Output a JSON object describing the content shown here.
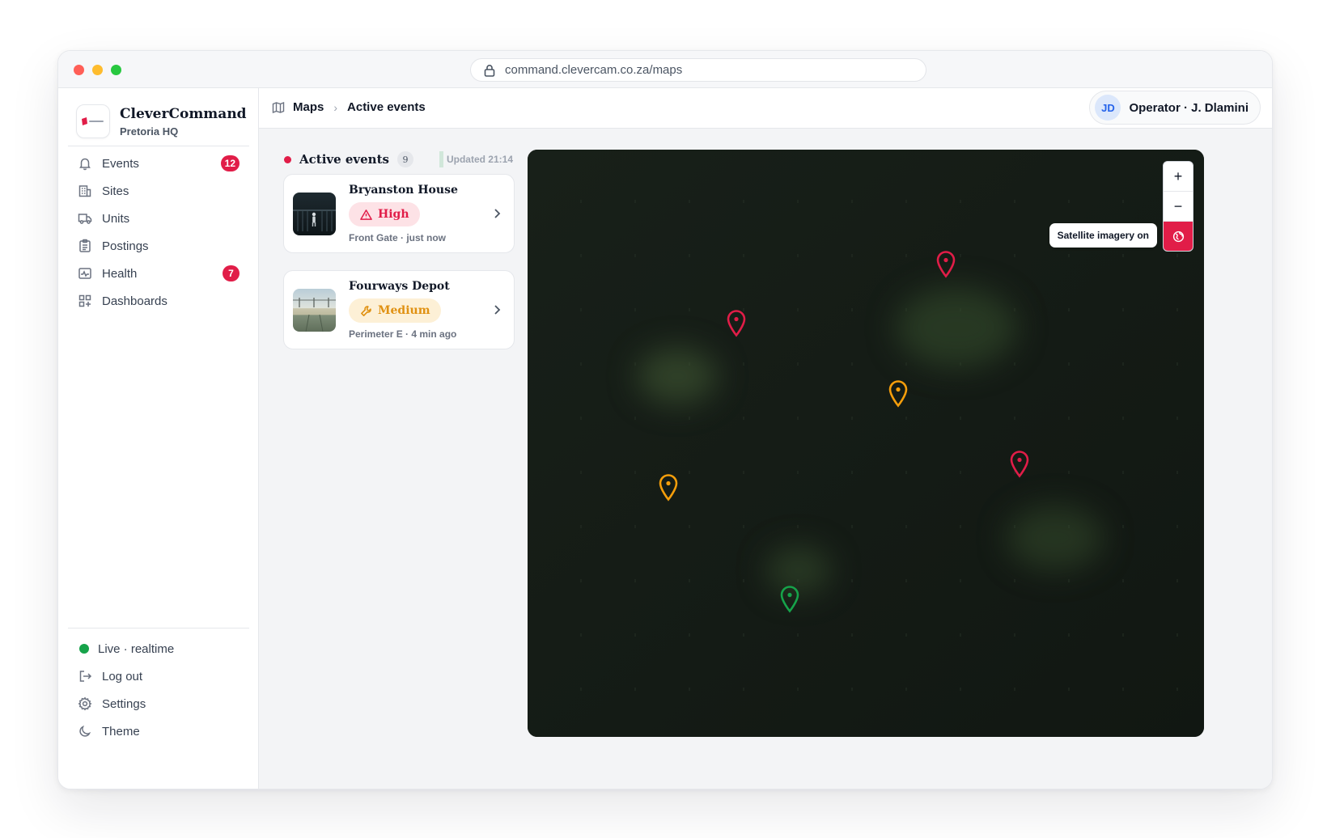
{
  "browser": {
    "url": "command.clevercam.co.za/maps"
  },
  "brand": {
    "name": "CleverCommand",
    "site": "Pretoria HQ"
  },
  "nav": [
    {
      "label": "Events",
      "icon": "bell-icon",
      "badge": "12"
    },
    {
      "label": "Sites",
      "icon": "building-icon"
    },
    {
      "label": "Units",
      "icon": "truck-icon"
    },
    {
      "label": "Postings",
      "icon": "clipboard-icon"
    },
    {
      "label": "Health",
      "icon": "pulse-icon",
      "badge": "7"
    },
    {
      "label": "Dashboards",
      "icon": "grid-icon"
    }
  ],
  "footer": {
    "live": "Live · realtime",
    "logout": "Log out",
    "settings": "Settings",
    "theme": "Theme"
  },
  "header": {
    "crumb_root": "Maps",
    "crumb_current": "Active events",
    "avatar_initials": "JD",
    "user": "Operator · J. Dlamini"
  },
  "events_panel": {
    "title": "Active events",
    "count": "9",
    "updated": "Updated 21:14",
    "cards": [
      {
        "site": "Bryanston House",
        "severity": "High",
        "meta": "Front Gate · just now"
      },
      {
        "site": "Fourways Depot",
        "severity": "Medium",
        "meta": "Perimeter E · 4 min ago"
      }
    ]
  },
  "map": {
    "zoom_in": "+",
    "zoom_out": "−",
    "tooltip": "Satellite imagery on",
    "colors": {
      "high": "#e11d48",
      "medium": "#f59e0b",
      "ok": "#16a34a"
    }
  }
}
